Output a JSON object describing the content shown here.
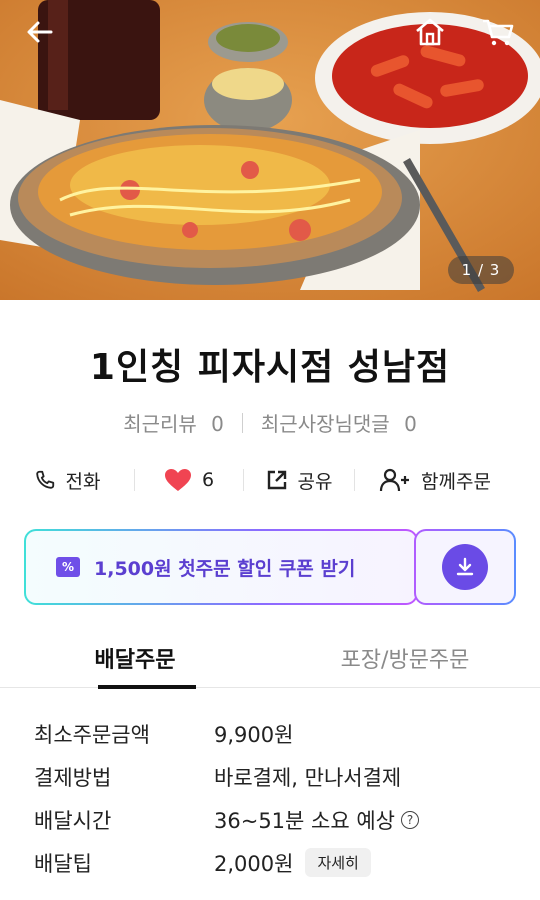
{
  "hero": {
    "counter": "1 / 3",
    "icons": {
      "back": "arrow-left-icon",
      "home": "home-icon",
      "cart": "cart-icon"
    }
  },
  "store": {
    "name": "1인칭 피자시점 성남점",
    "recent_review_label": "최근리뷰",
    "recent_review_count": "0",
    "owner_reply_label": "최근사장님댓글",
    "owner_reply_count": "0"
  },
  "actions": {
    "call": "전화",
    "like_count": "6",
    "share": "공유",
    "group_order": "함께주문"
  },
  "coupon": {
    "label": "1,500원 첫주문 할인 쿠폰 받기"
  },
  "tabs": [
    {
      "label": "배달주문",
      "active": true
    },
    {
      "label": "포장/방문주문",
      "active": false
    }
  ],
  "details": {
    "min_order_label": "최소주문금액",
    "min_order_value": "9,900원",
    "payment_label": "결제방법",
    "payment_value": "바로결제, 만나서결제",
    "delivery_time_label": "배달시간",
    "delivery_time_value": "36~51분 소요 예상",
    "tip_label": "배달팁",
    "tip_value": "2,000원",
    "tip_detail_button": "자세히"
  },
  "colors": {
    "accent": "#6a4be6",
    "heart": "#f04452",
    "text_gray": "#8a8a8a"
  }
}
